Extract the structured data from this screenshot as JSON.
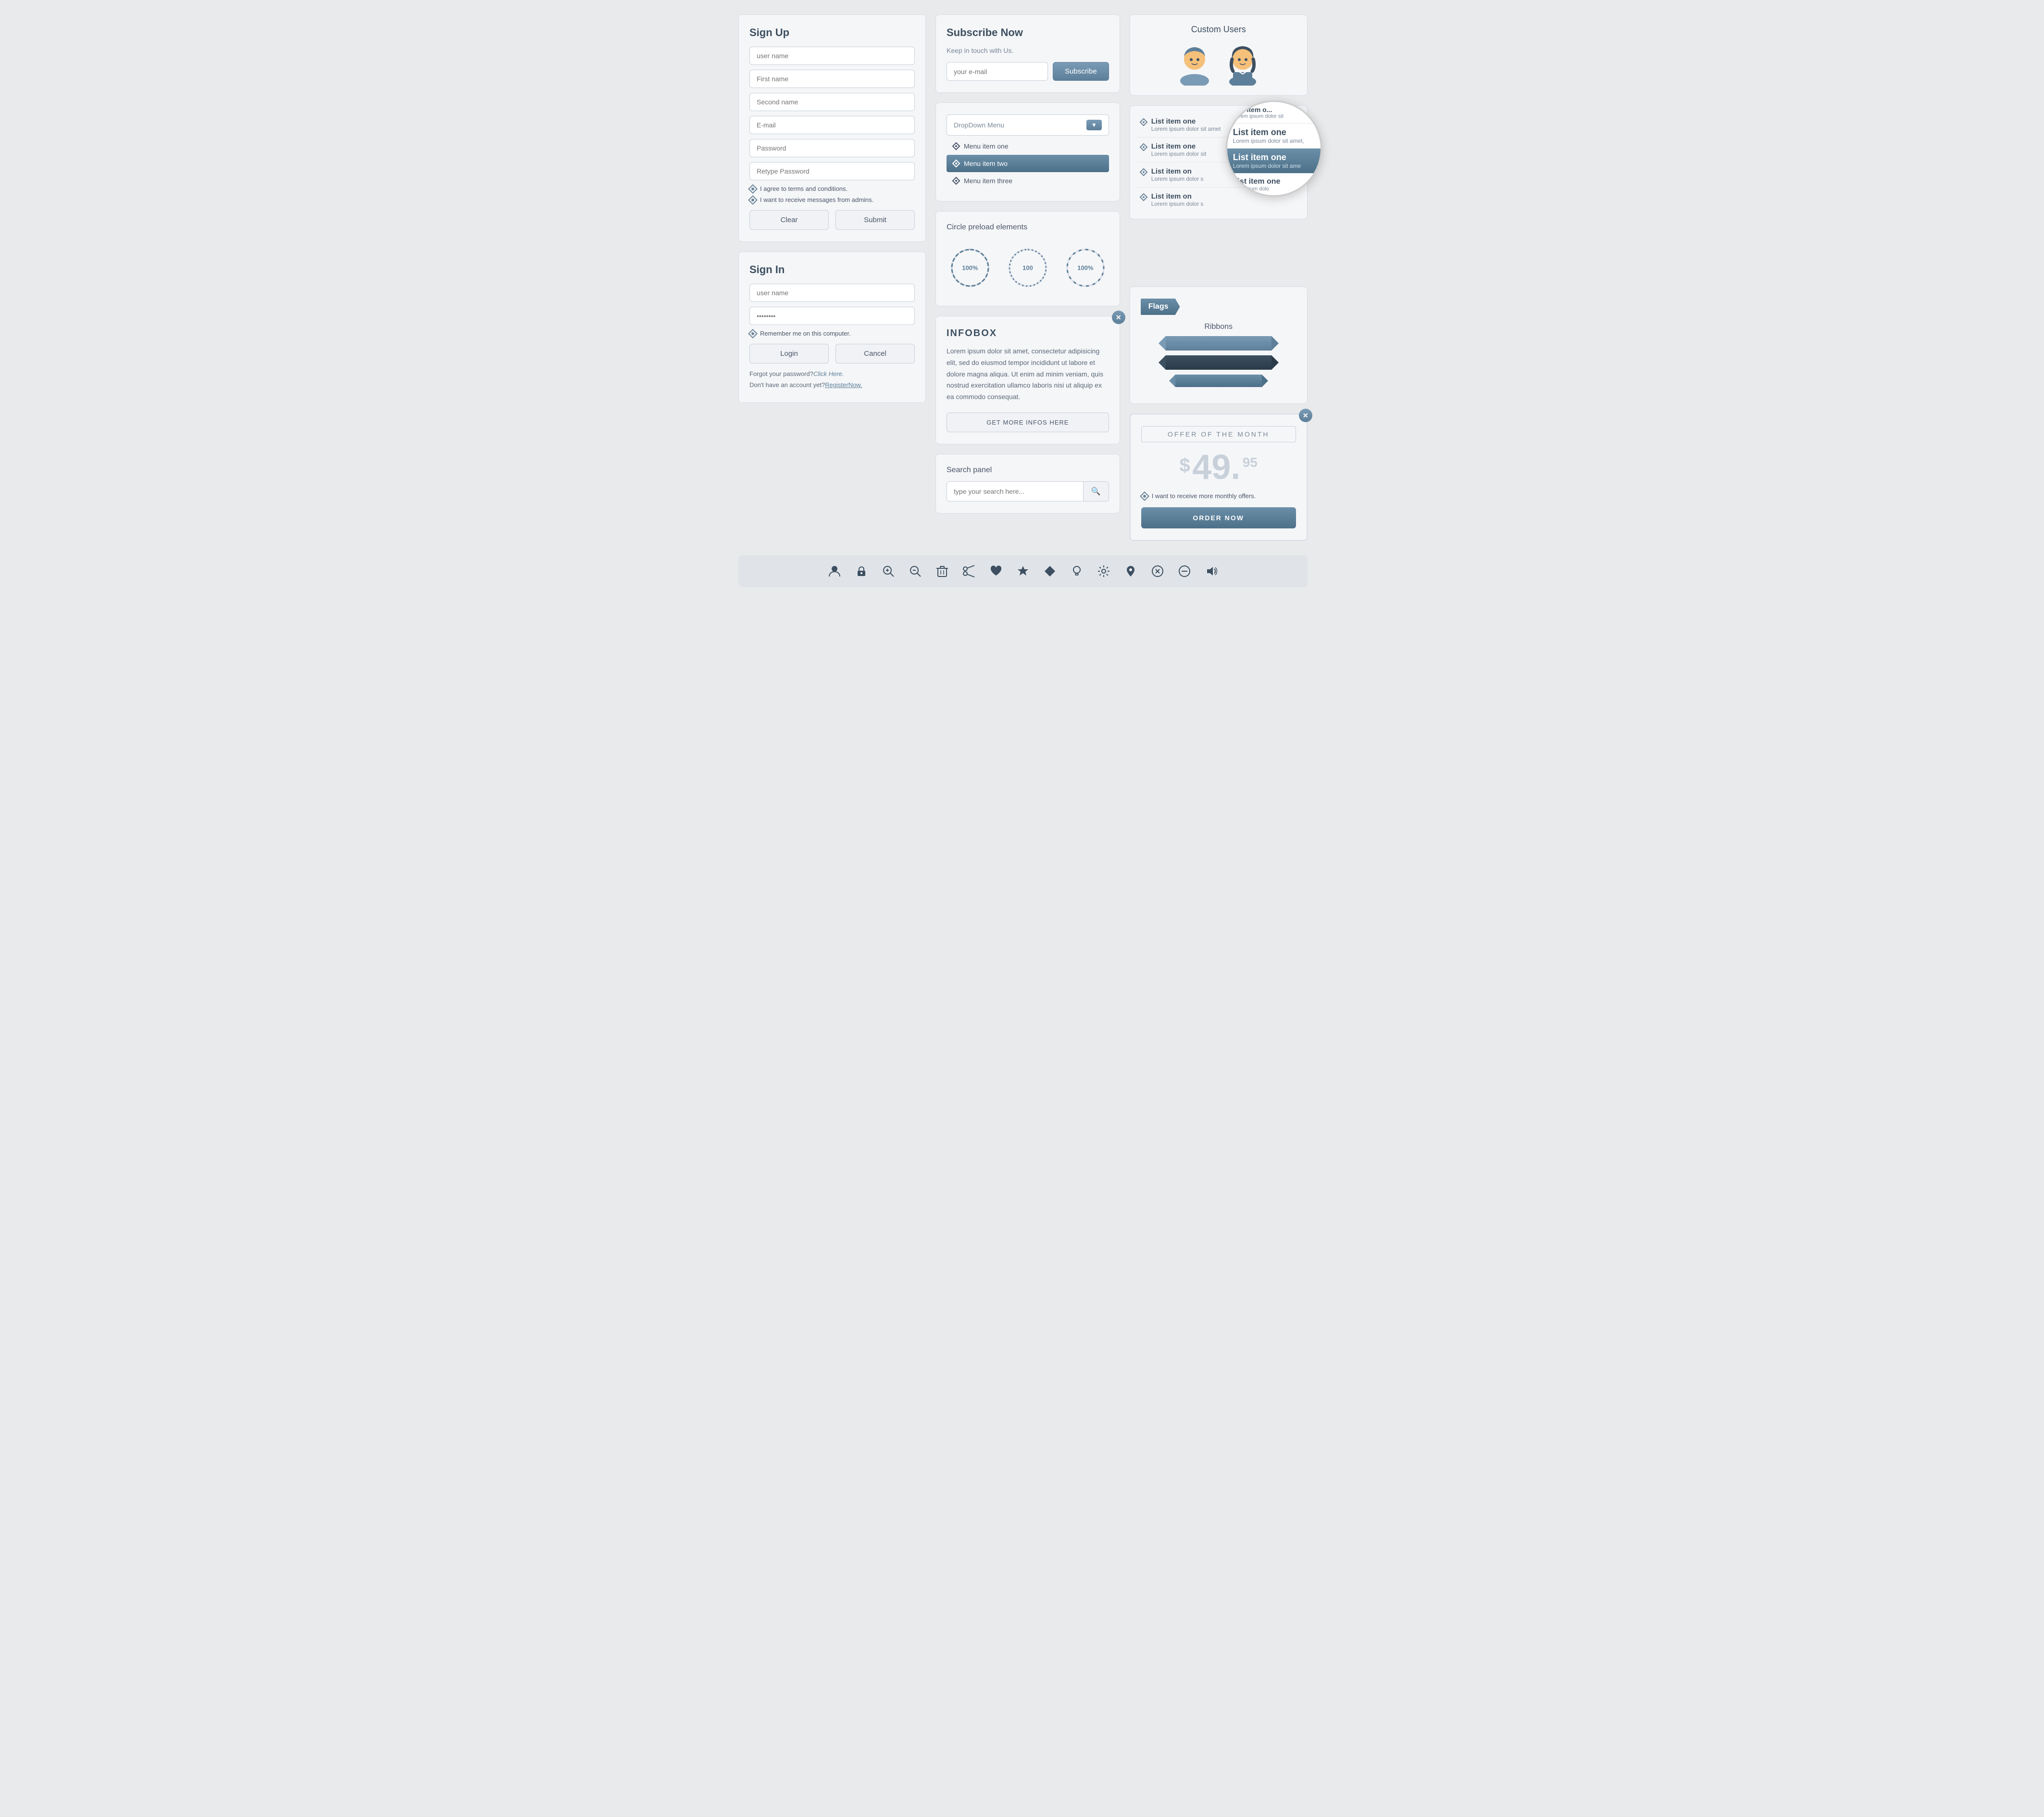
{
  "signup": {
    "title": "Sign Up",
    "fields": [
      {
        "id": "username",
        "placeholder": "user name",
        "type": "text"
      },
      {
        "id": "firstname",
        "placeholder": "First name",
        "type": "text"
      },
      {
        "id": "secondname",
        "placeholder": "Second name",
        "type": "text"
      },
      {
        "id": "email",
        "placeholder": "E-mail",
        "type": "email"
      },
      {
        "id": "password",
        "placeholder": "Password",
        "type": "password"
      },
      {
        "id": "retype",
        "placeholder": "Retype Password",
        "type": "password"
      }
    ],
    "checkboxes": [
      "I agree to terms and conditions.",
      "I want to receive messages from admins."
    ],
    "clear_btn": "Clear",
    "submit_btn": "Submit"
  },
  "signin": {
    "title": "Sign In",
    "fields": [
      {
        "id": "si_username",
        "placeholder": "user name",
        "type": "text"
      },
      {
        "id": "si_password",
        "placeholder": "••••••••",
        "type": "password"
      }
    ],
    "checkbox": "Remember me on this computer.",
    "login_btn": "Login",
    "cancel_btn": "Cancel",
    "forgot_text": "Forgot your password?",
    "forgot_link": "Click Here.",
    "register_text": "Don't have an account yet?",
    "register_link": "RegisterNow."
  },
  "subscribe": {
    "title": "Subscribe Now",
    "subtitle": "Keep in touch with Us.",
    "placeholder": "your e-mail",
    "btn_label": "Subscribe"
  },
  "dropdown": {
    "placeholder": "DropDown Menu",
    "items": [
      {
        "label": "Menu item  one",
        "active": false
      },
      {
        "label": "Menu item  two",
        "active": true
      },
      {
        "label": "Menu item three",
        "active": false
      }
    ]
  },
  "preload": {
    "title": "Circle preload elements",
    "circles": [
      {
        "label": "100%",
        "type": "dashed"
      },
      {
        "label": "100",
        "type": "dotted"
      },
      {
        "label": "100%",
        "type": "sparse"
      }
    ]
  },
  "infobox": {
    "title": "INFOBOX",
    "text": "Lorem ipsum dolor sit amet, consectetur adipisicing elit, sed do eiusmod tempor incididunt ut labore et dolore magna aliqua. Ut enim ad minim veniam, quis nostrud exercitation ullamco laboris nisi ut aliquip ex ea commodo consequat.",
    "btn_label": "GET MORE INFOS HERE"
  },
  "search": {
    "title": "Search panel",
    "placeholder": "type your search here...",
    "btn_icon": "🔍"
  },
  "custom_users": {
    "title": "Custom Users"
  },
  "list_items": {
    "items": [
      {
        "title": "List item one",
        "desc": "Lorem ipsum dolor sit amet",
        "active": false
      },
      {
        "title": "List item one",
        "desc": "Lorem ipsum dolor sit",
        "active": false
      },
      {
        "title": "List item one",
        "desc": "Lorem ipsum dolor si",
        "active": false
      },
      {
        "title": "List item one",
        "desc": "Lorem ipsum dolor si",
        "active": false
      }
    ],
    "magnified": [
      {
        "title": "List item o...",
        "desc": "Lorem ipsum dolor sit",
        "active": false
      },
      {
        "title": "List item one",
        "desc": "Lorem ipsum dolor sit amet,",
        "active": false
      },
      {
        "title": "List item one",
        "desc": "Lorem ipsum dolor sit ame",
        "active": true
      },
      {
        "title": "List item one",
        "desc": "rem ipsum dolo",
        "active": false
      }
    ]
  },
  "flags": {
    "label": "Flags"
  },
  "ribbons": {
    "title": "Ribbons",
    "items": [
      {
        "color": "medium"
      },
      {
        "color": "dark"
      },
      {
        "color": "medium"
      }
    ]
  },
  "offer": {
    "title": "OFFER OF THE MONTH",
    "price_dollar": "$",
    "price_main": "49.",
    "price_cents": "95",
    "checkbox_label": "I want to receive more monthly offers.",
    "order_btn": "ORDER NOW"
  },
  "icons_bar": {
    "icons": [
      {
        "name": "person-icon",
        "symbol": "👤"
      },
      {
        "name": "lock-icon",
        "symbol": "🔒"
      },
      {
        "name": "zoom-in-icon",
        "symbol": "🔍"
      },
      {
        "name": "zoom-out-icon",
        "symbol": "🔎"
      },
      {
        "name": "trash-icon",
        "symbol": "🗑"
      },
      {
        "name": "scissors-icon",
        "symbol": "✂"
      },
      {
        "name": "heart-icon",
        "symbol": "♥"
      },
      {
        "name": "star-icon",
        "symbol": "★"
      },
      {
        "name": "diamond-icon",
        "symbol": "◆"
      },
      {
        "name": "bulb-icon",
        "symbol": "💡"
      },
      {
        "name": "gear-icon",
        "symbol": "⚙"
      },
      {
        "name": "location-icon",
        "symbol": "📍"
      },
      {
        "name": "close-icon",
        "symbol": "✕"
      },
      {
        "name": "minus-icon",
        "symbol": "⊖"
      },
      {
        "name": "volume-icon",
        "symbol": "🔊"
      }
    ]
  }
}
